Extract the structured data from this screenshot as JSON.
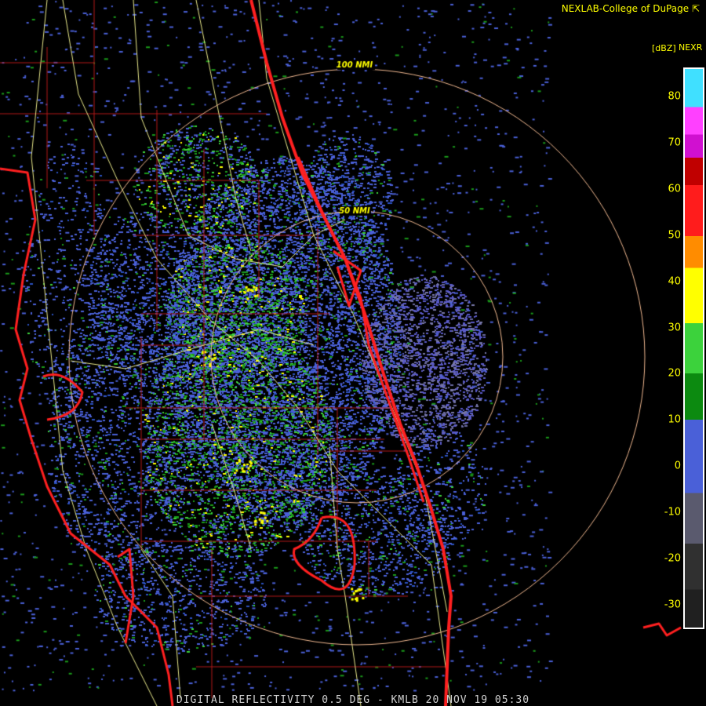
{
  "credit": "NEXLAB-College of DuPage",
  "credit_icon": "cursor-arrow-icon",
  "legend": {
    "product": "NEXR",
    "units": "[dBZ]",
    "ticks": [
      "80",
      "70",
      "60",
      "50",
      "40",
      "30",
      "20",
      "10",
      "0",
      "-10",
      "-20",
      "-30"
    ],
    "colors": {
      "bg": "#000000",
      "very_light": "#303030",
      "light_gray": "#5a5a6e",
      "blue": "#4a60d8",
      "dark_green": "#0c8a10",
      "green": "#3cd23c",
      "yellow": "#ffff00",
      "orange": "#ff8c00",
      "red": "#ff1c1c",
      "magenta": "#ff40ff",
      "cyan": "#40e0ff"
    }
  },
  "range_rings": {
    "inner": "50 NMI",
    "outer": "100 NMI"
  },
  "caption": "DIGITAL REFLECTIVITY 0.5 DEG - KMLB 20 NOV 19 05:30",
  "map_colors": {
    "coast": "#ff2020",
    "county": "#b01818",
    "road": "#e8e88a",
    "ring": "#f0b890"
  }
}
